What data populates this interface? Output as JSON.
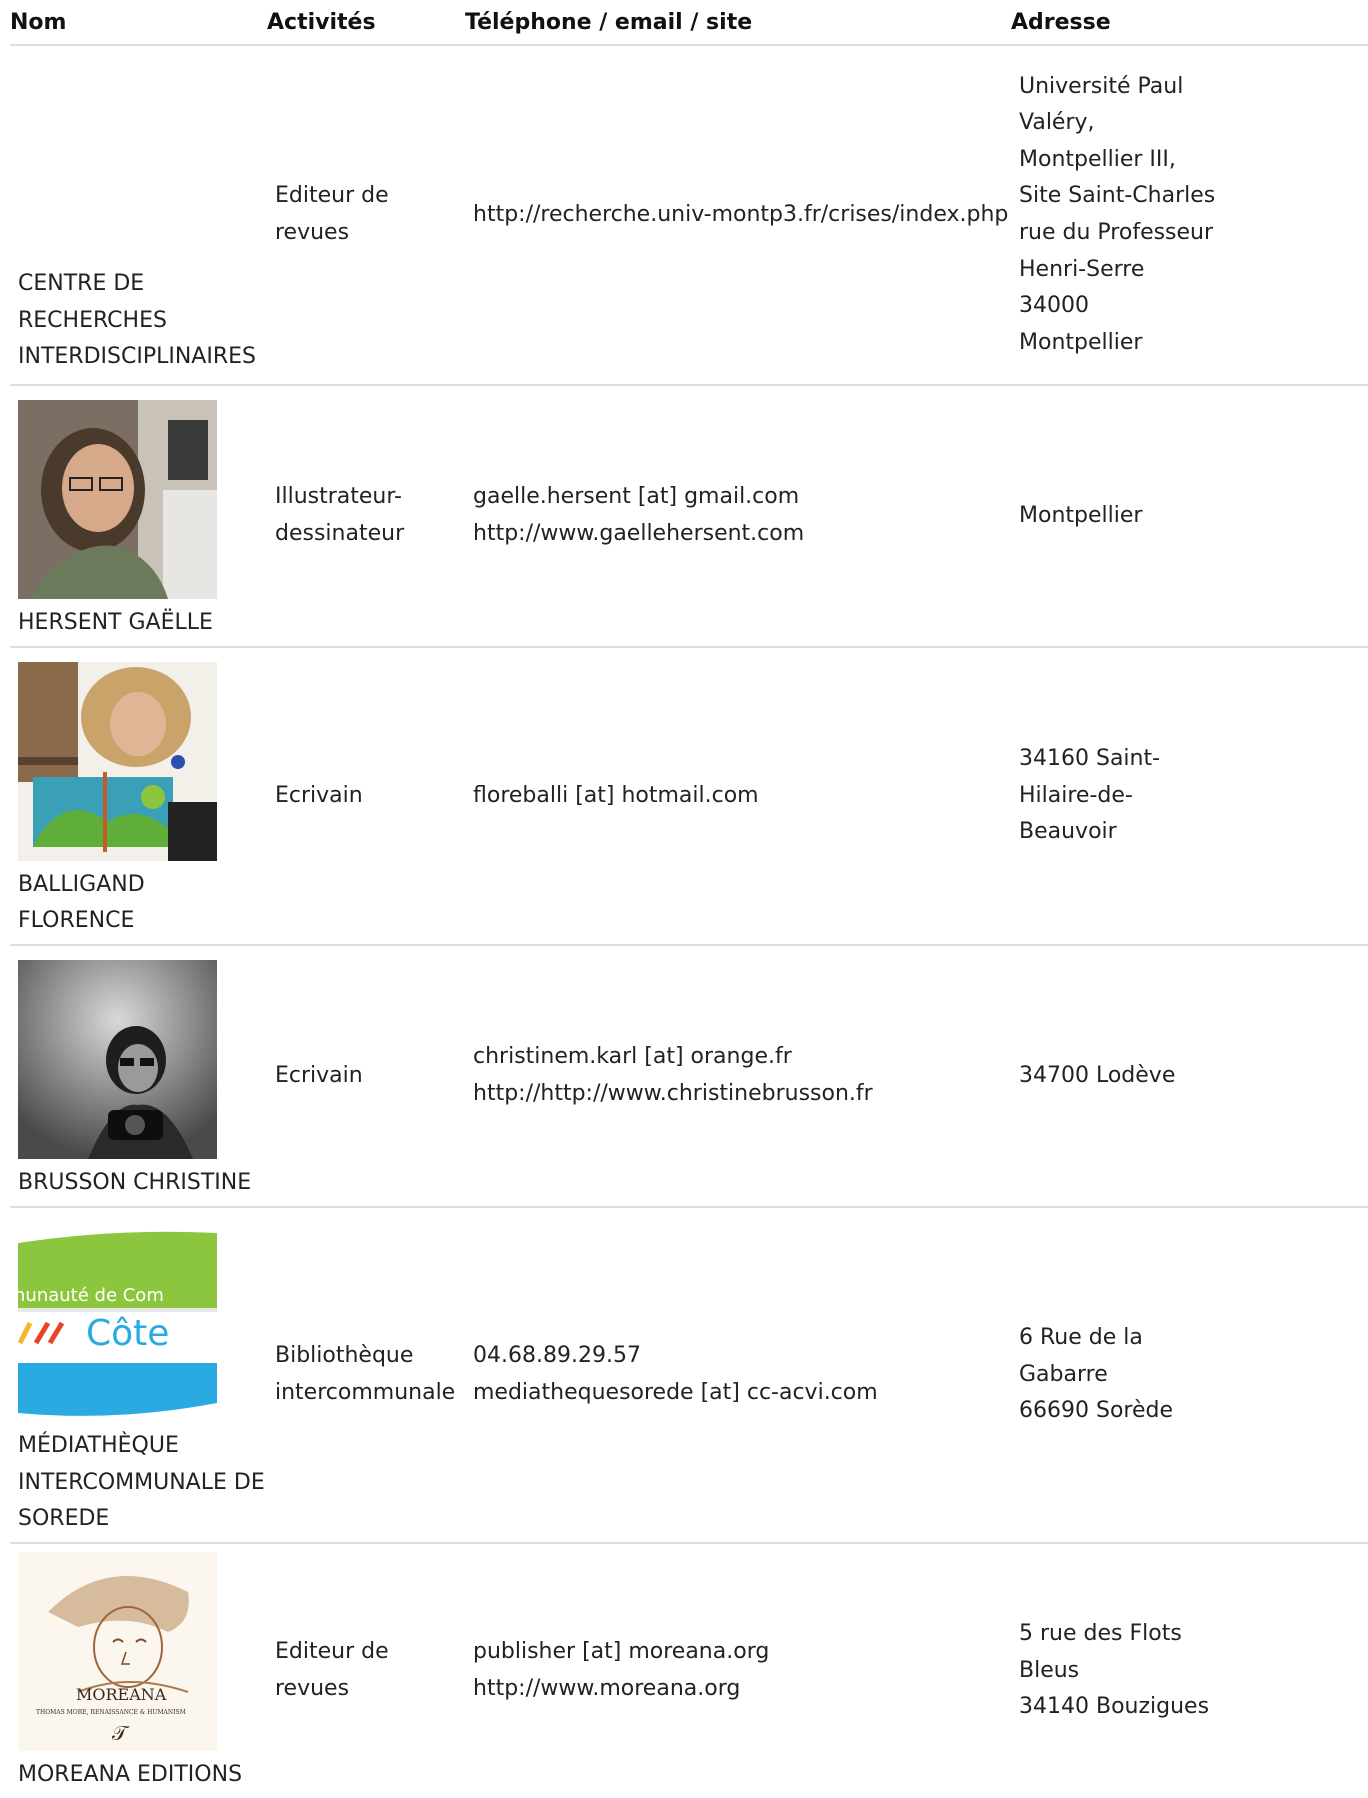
{
  "headers": {
    "nom": "Nom",
    "activites": "Activités",
    "contact": "Téléphone / email / site",
    "adresse": "Adresse"
  },
  "rows": [
    {
      "nom": [
        "CENTRE DE",
        "RECHERCHES",
        "INTERDISCIPLINAIRES"
      ],
      "activite": [
        "Editeur de",
        "revues"
      ],
      "contact": [
        "http://recherche.univ-montp3.fr/crises/index.php"
      ],
      "adresse": [
        "Université Paul",
        "Valéry,",
        "Montpellier III,",
        "Site Saint-Charles",
        "rue du Professeur",
        "Henri-Serre",
        "34000",
        "Montpellier"
      ]
    },
    {
      "nom": [
        "HERSENT GAËLLE"
      ],
      "activite": [
        "Illustrateur-",
        "dessinateur"
      ],
      "contact": [
        "gaelle.hersent [at] gmail.com",
        "http://www.gaellehersent.com"
      ],
      "adresse": [
        "Montpellier"
      ]
    },
    {
      "nom": [
        "BALLIGAND",
        "FLORENCE"
      ],
      "activite": [
        "Ecrivain"
      ],
      "contact": [
        "floreballi [at] hotmail.com"
      ],
      "adresse": [
        "34160 Saint-",
        "Hilaire-de-",
        "Beauvoir"
      ]
    },
    {
      "nom": [
        "BRUSSON CHRISTINE"
      ],
      "activite": [
        "Ecrivain"
      ],
      "contact": [
        "christinem.karl [at] orange.fr",
        "http://http://www.christinebrusson.fr"
      ],
      "adresse": [
        "34700 Lodève"
      ]
    },
    {
      "nom": [
        "MÉDIATHÈQUE",
        "INTERCOMMUNALE DE",
        "SOREDE"
      ],
      "activite": [
        "Bibliothèque",
        "intercommunale"
      ],
      "contact": [
        "04.68.89.29.57",
        "mediathequesorede [at] cc-acvi.com"
      ],
      "adresse": [
        "6 Rue de la",
        "Gabarre",
        "66690 Sorède"
      ]
    },
    {
      "nom": [
        "MOREANA EDITIONS"
      ],
      "activite": [
        "Editeur de",
        "revues"
      ],
      "contact": [
        "publisher [at] moreana.org",
        "http://www.moreana.org"
      ],
      "adresse": [
        "5 rue des Flots",
        "Bleus",
        "34140 Bouzigues"
      ]
    }
  ],
  "logo_text": {
    "communaute": "nunauté de Com",
    "cote": "Côte",
    "moreana": "MOREANA",
    "moreana_sub": "THOMAS MORE, RENAISSANCE & HUMANISM"
  },
  "colors": {
    "border": "#dddddd",
    "logo_green": "#8cc63f",
    "logo_blue": "#29abe2",
    "logo_red": "#e8432a",
    "logo_yellow": "#f7b52c"
  }
}
